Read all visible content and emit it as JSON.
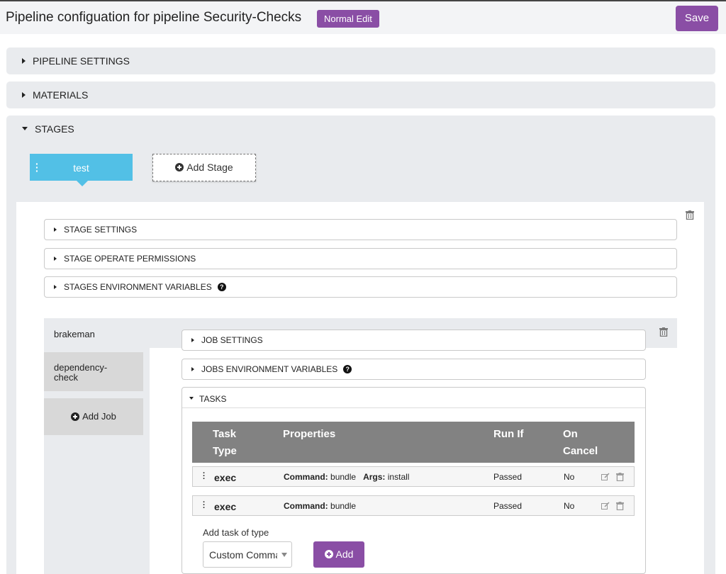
{
  "header": {
    "title": "Pipeline configuation for pipeline Security-Checks",
    "mode_label": "Normal Edit",
    "save_label": "Save"
  },
  "sections": {
    "pipeline_settings": "PIPELINE SETTINGS",
    "materials": "MATERIALS",
    "stages": "STAGES"
  },
  "stage": {
    "name": "test",
    "add_stage_label": "Add Stage",
    "settings": "STAGE SETTINGS",
    "operate_permissions": "STAGE OPERATE PERMISSIONS",
    "env_variables": "STAGES ENVIRONMENT VARIABLES"
  },
  "jobs": {
    "items": [
      "brakeman",
      "dependency-check"
    ],
    "add_job_label": "Add Job",
    "settings": "JOB SETTINGS",
    "env_variables": "JOBS ENVIRONMENT VARIABLES",
    "tasks_title": "TASKS"
  },
  "tasks_table": {
    "headers": {
      "type_line1": "Task",
      "type_line2": "Type",
      "properties": "Properties",
      "run_if": "Run If",
      "on_line1": "On",
      "on_line2": "Cancel"
    },
    "rows": [
      {
        "type": "exec",
        "command_label": "Command:",
        "command": "bundle",
        "args_label": "Args:",
        "args": "install",
        "run_if": "Passed",
        "on_cancel": "No"
      },
      {
        "type": "exec",
        "command_label": "Command:",
        "command": "bundle",
        "run_if": "Passed",
        "on_cancel": "No"
      }
    ]
  },
  "add_task": {
    "label": "Add task of type",
    "selected": "Custom Command",
    "button_label": "Add"
  },
  "colors": {
    "accent": "#8a4ea5",
    "stage_tab": "#52c0e6",
    "table_header": "#828282"
  }
}
